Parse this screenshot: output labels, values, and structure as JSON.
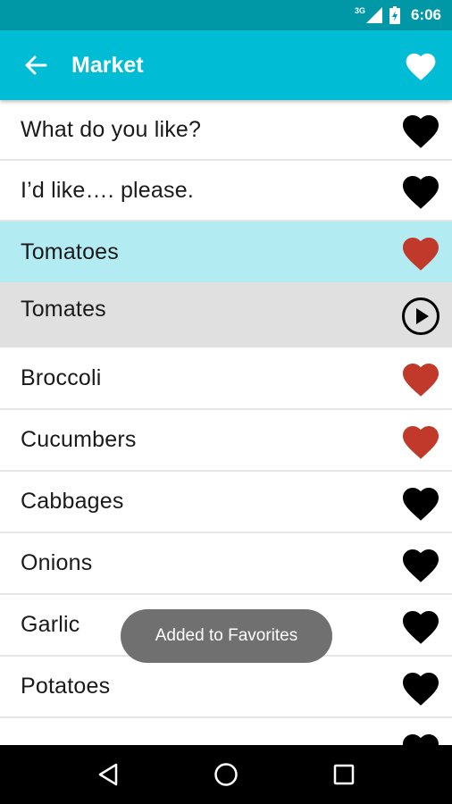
{
  "statusbar": {
    "network": "3G",
    "time": "6:06",
    "icons": [
      "signal-icon",
      "battery-icon"
    ]
  },
  "appbar": {
    "title": "Market",
    "back_icon": "arrow-back-icon",
    "favorite_icon": "heart-icon"
  },
  "colors": {
    "statusbar": "#0097a7",
    "appbar": "#00bcd4",
    "selected_row": "#b2ebf2",
    "translation_row": "#e0e0e0",
    "heart_favorite": "#c0392b",
    "heart_default": "#000000"
  },
  "items": [
    {
      "label": "What do you like?",
      "favorite": false
    },
    {
      "label": "I’d like…. please.",
      "favorite": false
    },
    {
      "label": "Tomatoes",
      "favorite": true,
      "selected": true
    },
    {
      "translation": "Tomates",
      "play_icon": "play-circle-icon"
    },
    {
      "label": "Broccoli",
      "favorite": true
    },
    {
      "label": "Cucumbers",
      "favorite": true
    },
    {
      "label": "Cabbages",
      "favorite": false
    },
    {
      "label": "Onions",
      "favorite": false
    },
    {
      "label": "Garlic",
      "favorite": false
    },
    {
      "label": "Potatoes",
      "favorite": false
    },
    {
      "label": "",
      "favorite": false
    }
  ],
  "toast": {
    "text": "Added to Favorites"
  },
  "navbar": {
    "icons": [
      "nav-back-icon",
      "nav-home-icon",
      "nav-recents-icon"
    ]
  }
}
